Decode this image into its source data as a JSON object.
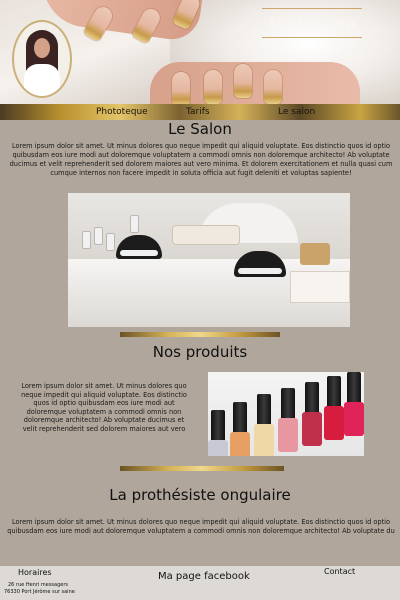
{
  "brand": {
    "name": "Nail Siana"
  },
  "nav": {
    "items": [
      {
        "label": "Phototeque"
      },
      {
        "label": "Tarifs"
      },
      {
        "label": "Le salon"
      }
    ]
  },
  "salon": {
    "title": "Le Salon",
    "text": "Lorem ipsum dolor sit amet. Ut minus dolores quo neque impedit qui aliquid voluptate. Eos distinctio quos id optio quibusdam eos iure modi aut doloremque voluptatem a commodi omnis non doloremque architecto! Ab voluptate ducimus et velit reprehenderit sed dolorem maiores aut vero minima. Et dolorem exercitationem et nulla quasi cum cumque internos non facere impedit in soluta officia aut fugit deleniti et voluptas sapiente!"
  },
  "produits": {
    "title": "Nos produits",
    "text": "Lorem ipsum dolor sit amet. Ut minus dolores quo neque impedit qui aliquid voluptate. Eos distinctio quos id optio quibusdam eos iure modi aut doloremque voluptatem a commodi omnis non doloremque architecto! Ab voluptate ducimus et velit reprehenderit sed dolorem maiores aut vero"
  },
  "prothesiste": {
    "title": "La prothésiste ongulaire",
    "text": "Lorem ipsum dolor sit amet. Ut minus dolores quo neque impedit qui aliquid voluptate. Eos distinctio quos id optio quibusdam eos iure modi aut doloremque voluptatem a commodi omnis non doloremque architecto! Ab voluptate du"
  },
  "footer": {
    "horaires": "Horaires",
    "address_line1": "26 rue Henri messagers",
    "address_line2": "76330 Port Jérôme sur saine",
    "facebook": "Ma page facebook",
    "contact": "Contact"
  },
  "colors": {
    "background": "#b0a69b",
    "gold": "#d6b357",
    "footer": "#ddd9d4"
  }
}
